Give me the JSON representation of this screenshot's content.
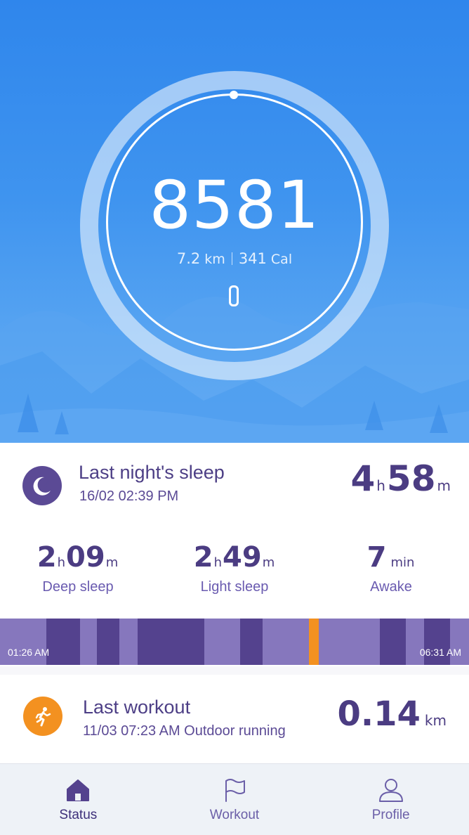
{
  "activity": {
    "steps": "8581",
    "distance_value": "7.2",
    "distance_unit": "km",
    "calories_value": "341",
    "calories_unit": "Cal",
    "goal_progress": 1.0
  },
  "sleep": {
    "title": "Last night's sleep",
    "timestamp": "16/02 02:39 PM",
    "total_hours": "4",
    "total_hours_unit": "h",
    "total_minutes": "58",
    "total_minutes_unit": "m",
    "deep": {
      "hours": "2",
      "hours_unit": "h",
      "minutes": "09",
      "minutes_unit": "m",
      "label": "Deep sleep"
    },
    "light": {
      "hours": "2",
      "hours_unit": "h",
      "minutes": "49",
      "minutes_unit": "m",
      "label": "Light sleep"
    },
    "awake": {
      "value": "7",
      "unit": "min",
      "label": "Awake"
    },
    "start_time": "01:26 AM",
    "end_time": "06:31 AM",
    "colors": {
      "deep": "#54428e",
      "light": "#8677bd",
      "awake": "#f39120"
    }
  },
  "workout": {
    "title": "Last workout",
    "details": "11/03 07:23 AM Outdoor running",
    "value": "0.14",
    "unit": "km"
  },
  "nav": {
    "items": [
      {
        "label": "Status",
        "icon": "home-icon",
        "active": true
      },
      {
        "label": "Workout",
        "icon": "flag-icon",
        "active": false
      },
      {
        "label": "Profile",
        "icon": "person-icon",
        "active": false
      }
    ]
  }
}
